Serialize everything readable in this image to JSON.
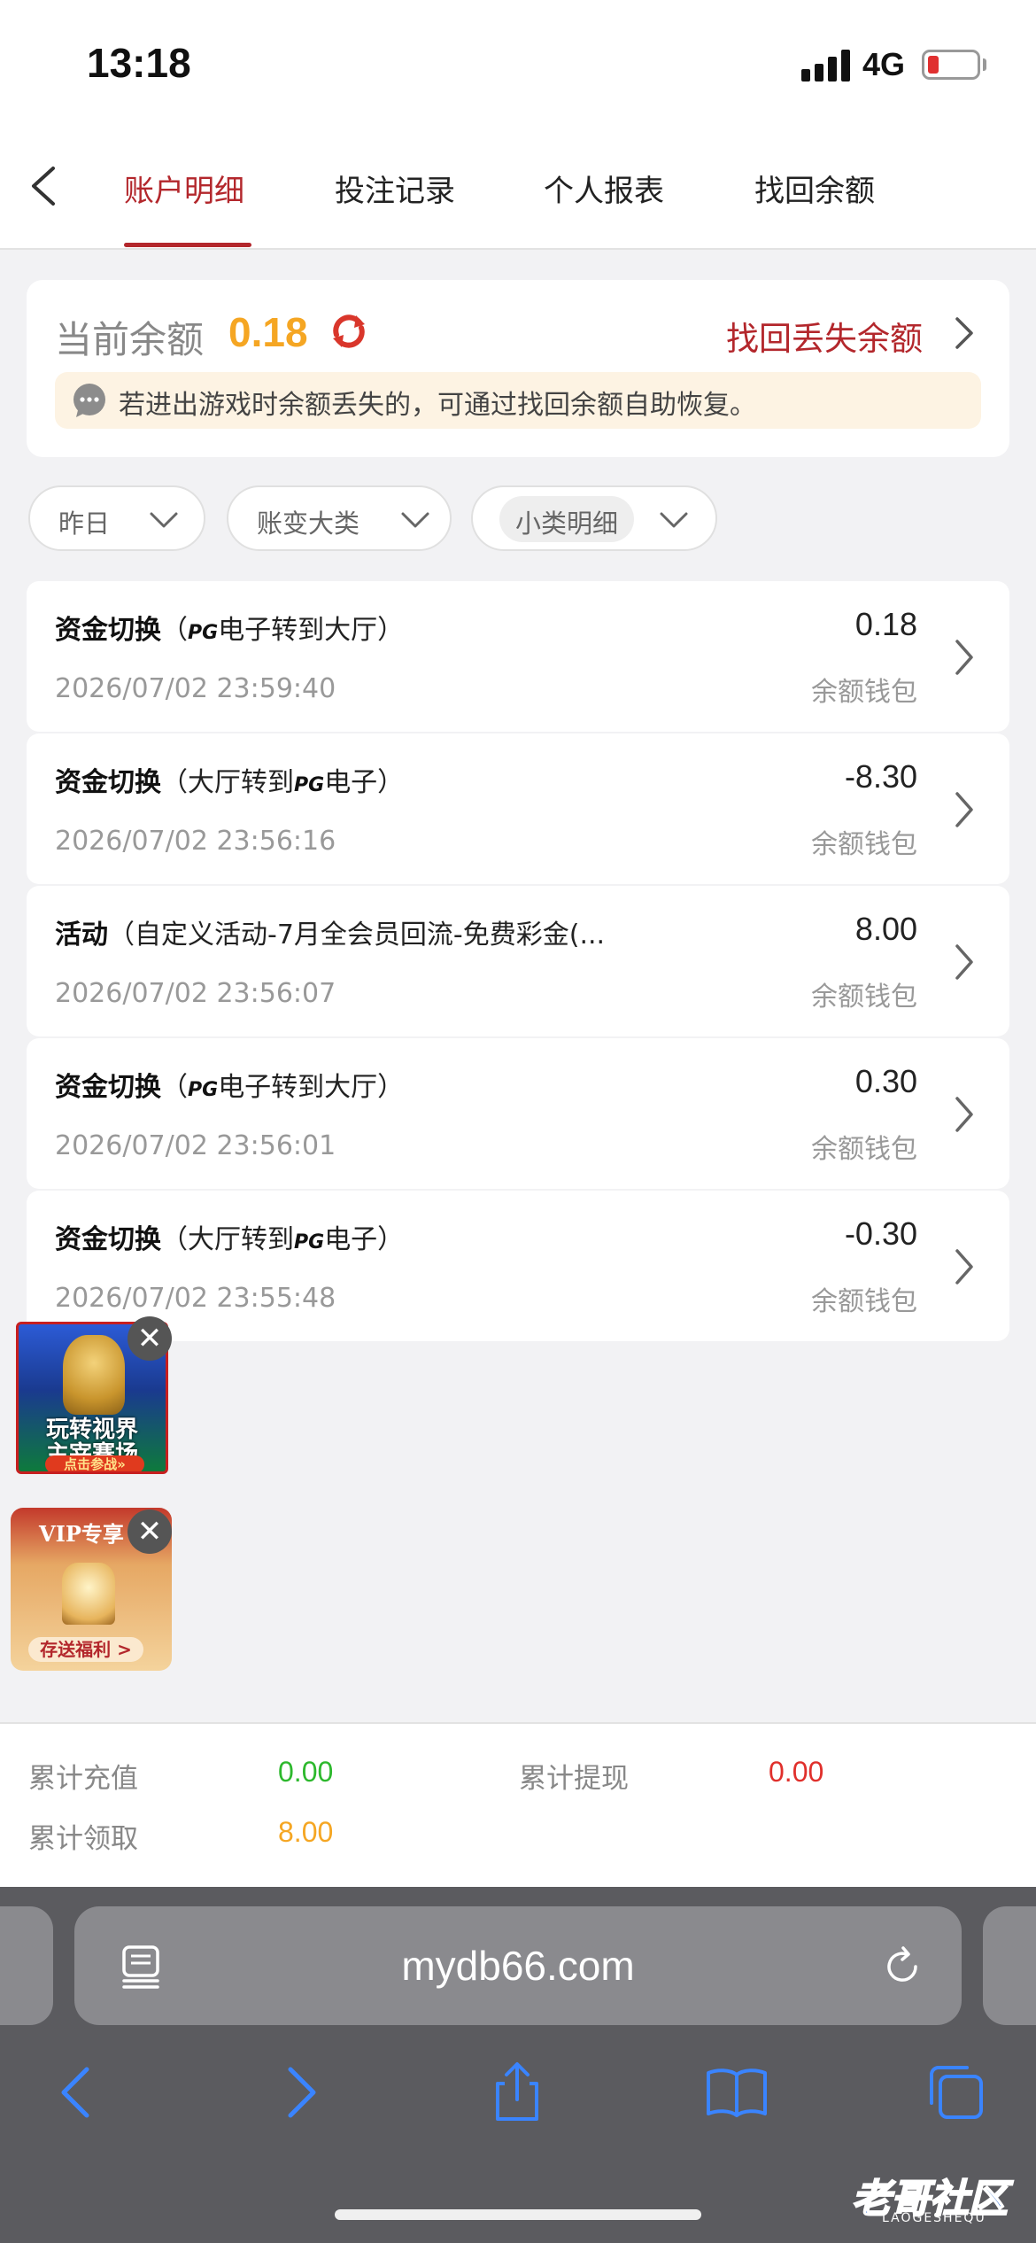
{
  "status_bar": {
    "time": "13:18",
    "network": "4G"
  },
  "tabs": [
    {
      "label": "账户明细",
      "active": true
    },
    {
      "label": "投注记录",
      "active": false
    },
    {
      "label": "个人报表",
      "active": false
    },
    {
      "label": "找回余额",
      "active": false
    }
  ],
  "balance": {
    "label": "当前余额",
    "value": "0.18",
    "recover_link": "找回丢失余额",
    "notice": "若进出游戏时余额丢失的，可通过找回余额自助恢复。"
  },
  "filters": {
    "date": "昨日",
    "category": "账变大类",
    "subcategory": "小类明细"
  },
  "transactions": [
    {
      "type": "资金切换",
      "detail_pre": "（",
      "pg": "PG",
      "detail_post": "电子转到大厅）",
      "time": "2026/07/02 23:59:40",
      "amount": "0.18",
      "wallet": "余额钱包"
    },
    {
      "type": "资金切换",
      "detail_pre": "（大厅转到",
      "pg": "PG",
      "detail_post": "电子）",
      "time": "2026/07/02 23:56:16",
      "amount": "-8.30",
      "wallet": "余额钱包"
    },
    {
      "type": "活动",
      "detail_pre": "（自定义活动-7月全会员回流-免费彩金(...",
      "pg": "",
      "detail_post": "",
      "time": "2026/07/02 23:56:07",
      "amount": "8.00",
      "wallet": "余额钱包"
    },
    {
      "type": "资金切换",
      "detail_pre": "（",
      "pg": "PG",
      "detail_post": "电子转到大厅）",
      "time": "2026/07/02 23:56:01",
      "amount": "0.30",
      "wallet": "余额钱包"
    },
    {
      "type": "资金切换",
      "detail_pre": "（大厅转到",
      "pg": "PG",
      "detail_post": "电子）",
      "time": "2026/07/02 23:55:48",
      "amount": "-0.30",
      "wallet": "余额钱包"
    }
  ],
  "ads": {
    "worldcup": {
      "line1": "玩转视界",
      "line2": "主宰赛场",
      "cta": "点击参战»"
    },
    "vip": {
      "label": "VIP专享",
      "cta": "存送福利 >"
    }
  },
  "summary": {
    "deposit_label": "累计充值",
    "deposit_value": "0.00",
    "deposit_color": "#2db82d",
    "withdraw_label": "累计提现",
    "withdraw_value": "0.00",
    "withdraw_color": "#e0302c",
    "claim_label": "累计领取",
    "claim_value": "8.00",
    "claim_color": "#f5a623"
  },
  "browser": {
    "url": "mydb66.com"
  },
  "watermark": {
    "text": "老哥社区",
    "sub": "LAOGESHEQU"
  },
  "colors": {
    "accent": "#b3272c",
    "balance": "#f5a623",
    "safari_blue": "#3a84ff"
  },
  "icons": [
    "back-chevron-icon",
    "refresh-icon",
    "chevron-right-icon",
    "chat-bubble-icon",
    "chevron-down-icon",
    "close-icon",
    "reader-icon",
    "reload-icon",
    "back-arrow-icon",
    "forward-arrow-icon",
    "share-icon",
    "bookmarks-icon",
    "tabs-icon"
  ]
}
